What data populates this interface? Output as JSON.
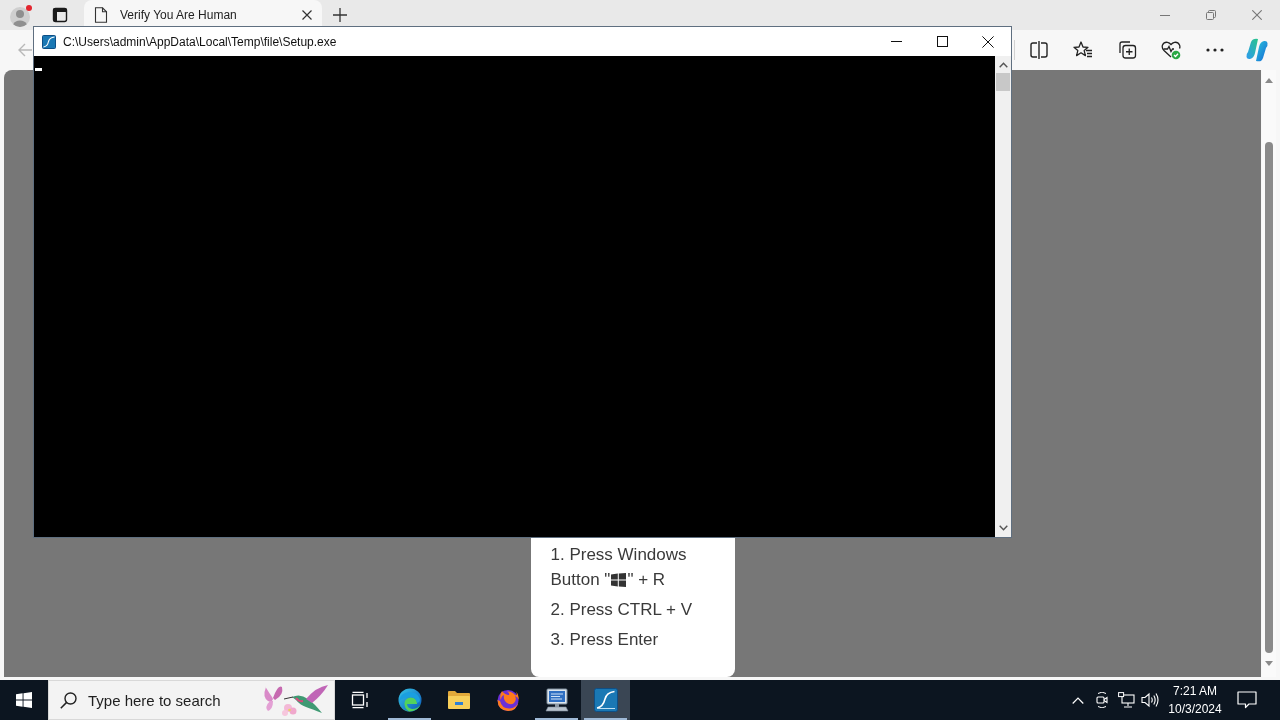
{
  "browser": {
    "tabs": [
      {
        "title": "Verify You Are Human",
        "selected": true
      }
    ]
  },
  "page": {
    "steps": [
      {
        "lines": [
          {
            "kind": "text",
            "text": "1. Press Windows"
          },
          {
            "kind": "key",
            "text": "Button \"",
            "text_after": "\" + R"
          }
        ]
      },
      {
        "lines": [
          {
            "kind": "text",
            "text": "2. Press CTRL + V"
          }
        ]
      },
      {
        "lines": [
          {
            "kind": "text",
            "text": "3. Press Enter"
          }
        ]
      }
    ]
  },
  "console": {
    "title": "C:\\Users\\admin\\AppData\\Local\\Temp\\file\\Setup.exe"
  },
  "taskbar": {
    "search": {
      "placeholder": "Type here to search"
    },
    "apps": [
      {
        "kind": "browser",
        "running": true,
        "selected": false
      },
      {
        "kind": "folder",
        "running": false,
        "selected": false
      },
      {
        "kind": "globe",
        "running": false,
        "selected": false
      },
      {
        "kind": "computer",
        "running": true,
        "selected": false
      },
      {
        "kind": "fin",
        "running": true,
        "selected": true
      }
    ],
    "clock": {
      "time": "7:21 AM",
      "date": "10/3/2024"
    }
  }
}
